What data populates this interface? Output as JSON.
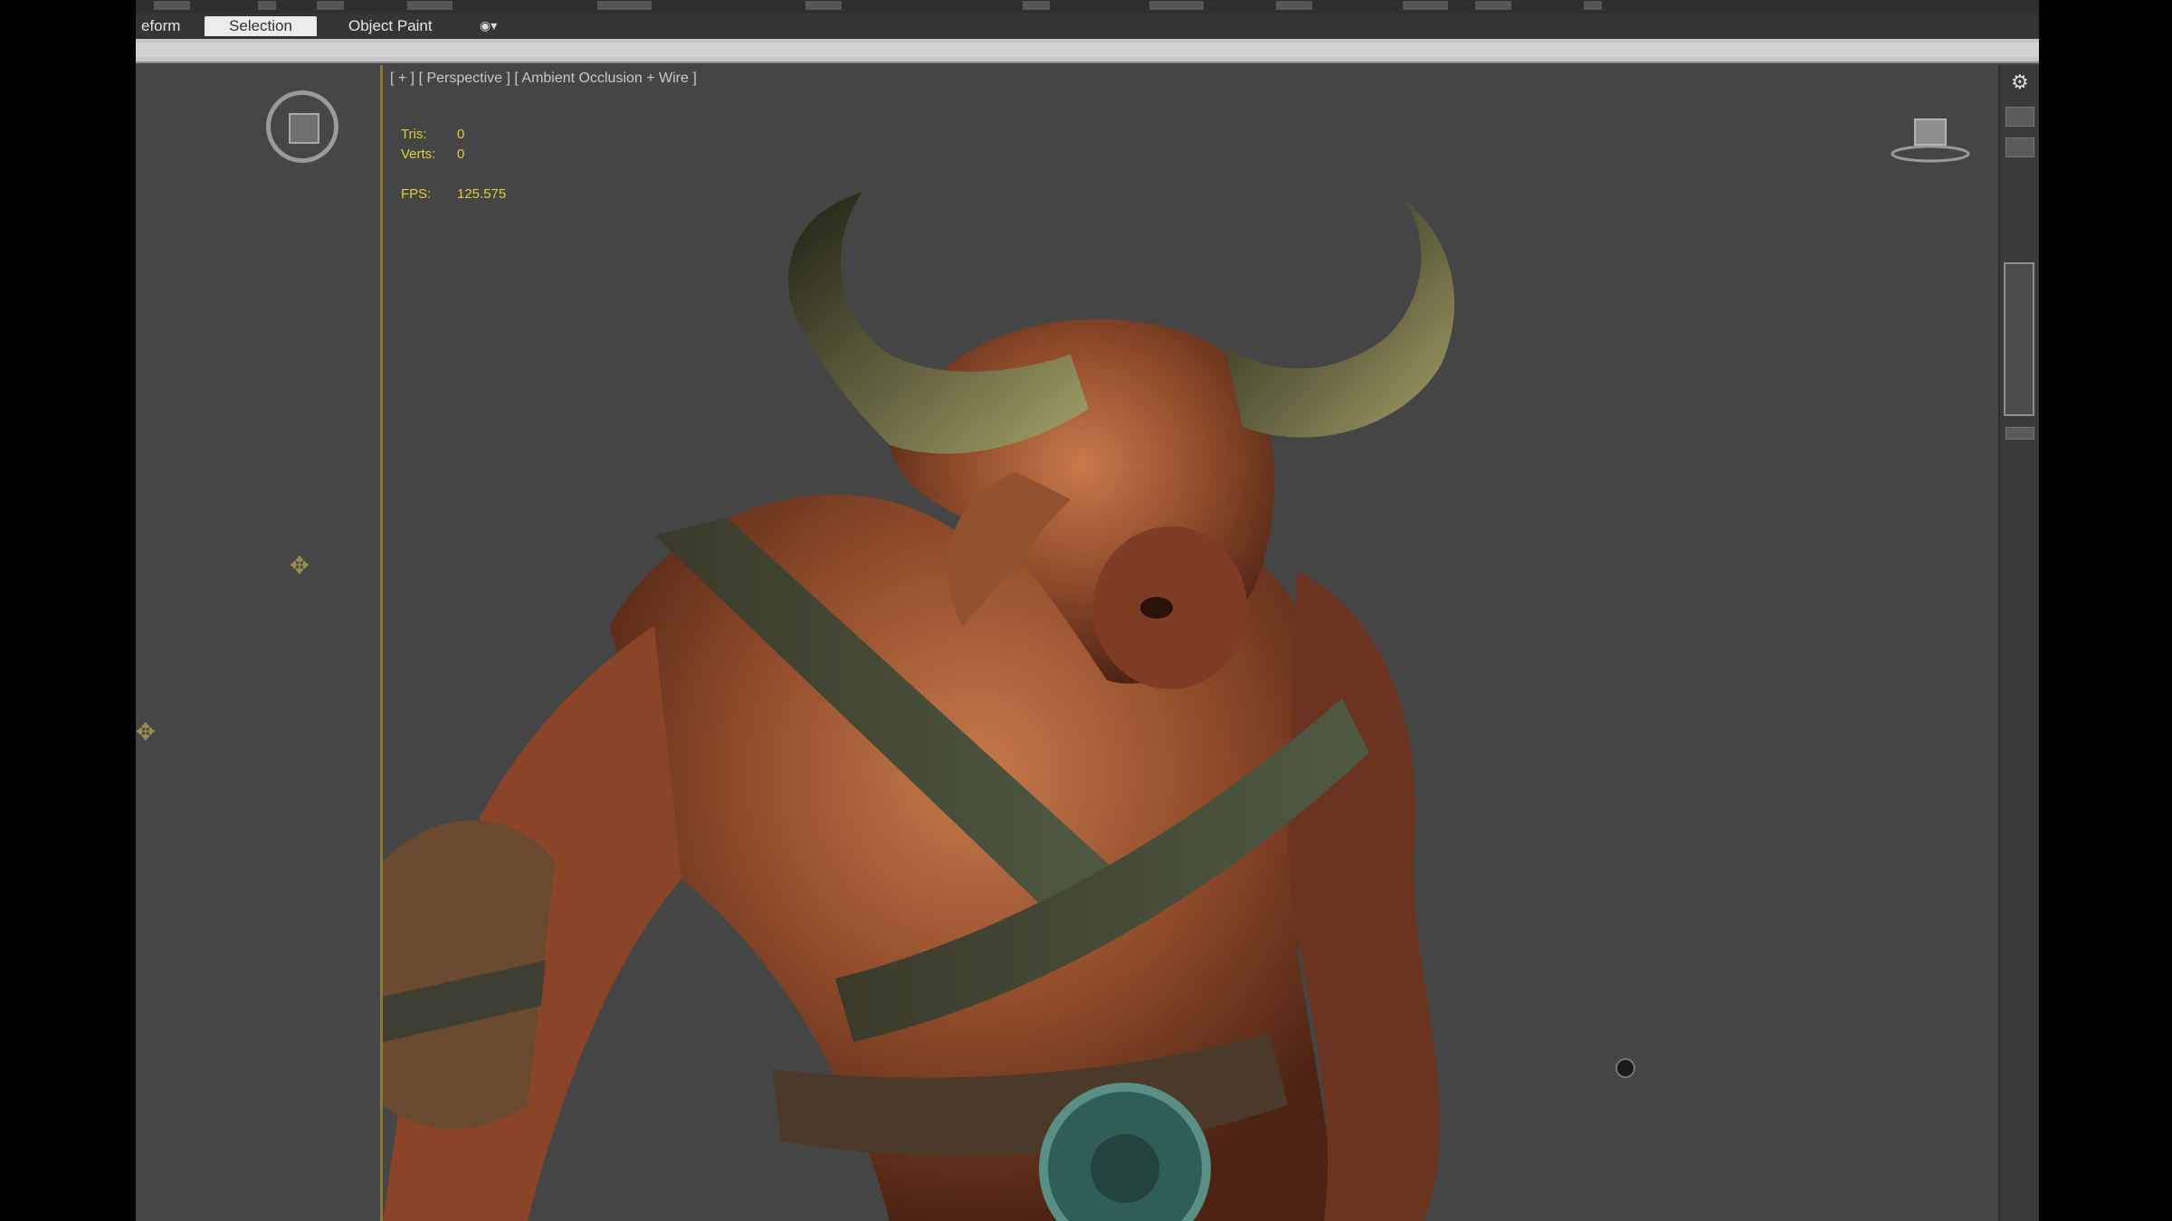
{
  "ribbon": {
    "tabs": [
      {
        "label": "eform"
      },
      {
        "label": "Selection"
      },
      {
        "label": "Object Paint"
      }
    ]
  },
  "viewport": {
    "label": "[ + ] [ Perspective ] [ Ambient Occlusion + Wire ]",
    "stats": [
      {
        "key": "Tris:",
        "value": "0"
      },
      {
        "key": "Verts:",
        "value": "0"
      }
    ],
    "fps": {
      "key": "FPS:",
      "value": "125.575"
    }
  },
  "colors": {
    "viewport_bg": "#454545",
    "stats_text": "#d9d040",
    "viewport_border": "#8a7a3a"
  }
}
